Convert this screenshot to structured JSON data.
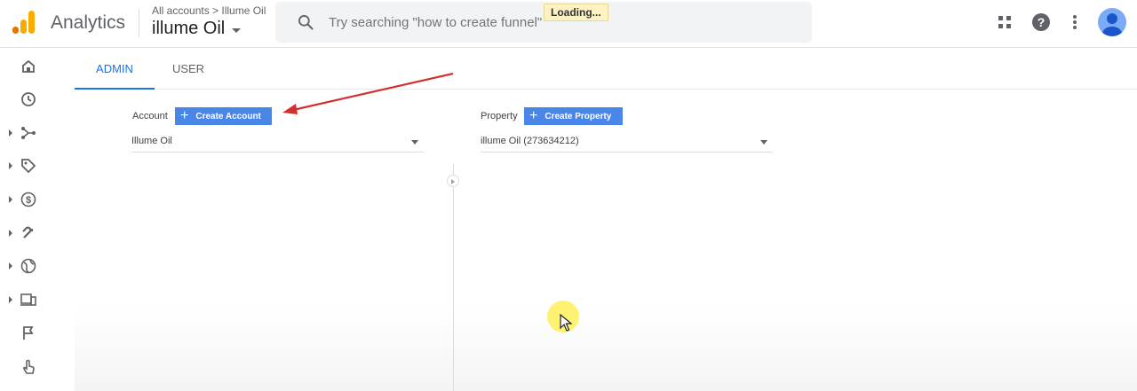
{
  "app": {
    "title": "Analytics",
    "breadcrumb": "All accounts > Illume Oil",
    "account_name": "illume Oil"
  },
  "search": {
    "placeholder": "Try searching \"how to create funnel\"",
    "loading_label": "Loading..."
  },
  "header_icons": [
    "apps-grid-icon",
    "help-icon",
    "more-vert-icon",
    "avatar"
  ],
  "sidebar": {
    "items": [
      {
        "icon": "home-icon",
        "expandable": false
      },
      {
        "icon": "clock-icon",
        "expandable": false
      },
      {
        "icon": "acquisition-icon",
        "expandable": true
      },
      {
        "icon": "tag-icon",
        "expandable": true
      },
      {
        "icon": "dollar-icon",
        "expandable": true
      },
      {
        "icon": "magnet-icon",
        "expandable": true
      },
      {
        "icon": "globe-icon",
        "expandable": true
      },
      {
        "icon": "devices-icon",
        "expandable": true
      },
      {
        "icon": "flag-icon",
        "expandable": false
      },
      {
        "icon": "touch-icon",
        "expandable": false
      }
    ]
  },
  "tabs": {
    "admin": "ADMIN",
    "user": "USER",
    "active": "ADMIN"
  },
  "account_column": {
    "label": "Account",
    "create_button": "Create Account",
    "selected": "Illume Oil"
  },
  "property_column": {
    "label": "Property",
    "create_button": "Create Property",
    "selected": "illume Oil (273634212)"
  },
  "colors": {
    "accent": "#1a73e8",
    "button": "#4a86e8",
    "annotation_arrow": "#d32f2f",
    "logo_orange": "#f9ab00",
    "logo_dark_orange": "#e37400"
  }
}
